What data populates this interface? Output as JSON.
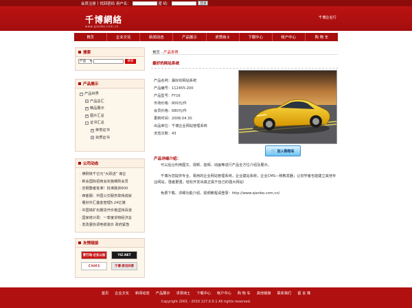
{
  "topbar": {
    "links": [
      "会员注册",
      "找回密码"
    ],
    "user_label": "用户名：",
    "pass_label": "密 码：",
    "login_button": "登录"
  },
  "header": {
    "logo": "千博網絡",
    "logo_sub": "www.qianbo.com.cn",
    "right_text": "千博企业行"
  },
  "nav": [
    "首页",
    "企业文化",
    "新闻动态",
    "产品展示",
    "求贤纳士",
    "下载中心",
    "帐户中心",
    "购 物 车"
  ],
  "sidebar": {
    "search_title": "搜索",
    "search_select": "产品",
    "search_button": "搜索",
    "products_title": "产品展示",
    "tree": [
      {
        "label": "产品世界",
        "icon": "minus-box",
        "level": 0
      },
      {
        "label": "产品总汇",
        "icon": "plus-box",
        "level": 1
      },
      {
        "label": "精品展示",
        "icon": "plus-box",
        "level": 1
      },
      {
        "label": "图片汇总",
        "icon": "plus-box",
        "level": 1
      },
      {
        "label": "证书汇总",
        "icon": "minus-box",
        "level": 1
      },
      {
        "label": "荣誉证书",
        "icon": "plus-box",
        "level": 2
      },
      {
        "label": "资质证书",
        "icon": "plus-box",
        "level": 2
      }
    ],
    "news_title": "公司动态",
    "news": [
      "佛刚铁千亿元“大跃进” 谋企",
      "新会国际招商会实施细则会员",
      "定钢整者批准！批准融资600",
      "西客服：中国公交服务取得成就",
      "看好外汇基金管理5.24亿港",
      "中国铁矿石期货开价格坚持百涨",
      "国家统计局：一季度货物经济总",
      "发改委协调电缆涨价 政府紧急"
    ],
    "links_title": "友情链接",
    "links": [
      {
        "text": "爱行动·企业公益",
        "bg": "#c81818",
        "fg": "#ffffff"
      },
      {
        "text": "YIZ.NET",
        "bg": "#1b1b1b",
        "fg": "#ffffff"
      },
      {
        "text": "ＣＮＭＳ",
        "bg": "#ffffff",
        "fg": "#b00000"
      },
      {
        "text": "千博·资讯共享",
        "bg": "#e8e8e8",
        "fg": "#b00000"
      }
    ]
  },
  "main": {
    "breadcrumb_home": "首页",
    "breadcrumb_sep": " - ",
    "breadcrumb_current": "产品世界",
    "product_title": "最好的网站系统",
    "spec": {
      "name": "产品名称：最好的网站系统",
      "code": "产品编号：112455-200",
      "model": "产品型号：FY16",
      "market_price": "市场价格：800元/件",
      "member_price": "会员价格：680元/件",
      "updated": "更新时间：2008.04.30",
      "seller": "出品单位：千博企业网站管理系统",
      "views": "浏览次数：43"
    },
    "cart_button": "加入购物车",
    "detail_title": "产品详细介绍：",
    "desc": [
      "可以后台利用图文、视频、音频、动画等进行产品全方位介绍及展示。",
      "千博为您提供专业、易用的企业网站管理系统，企业建站系统，企业CMS—移教发器；让初学者也能建立其他专业网站，强者更强，轻松开发出真正属于自己的强大网站!",
      "免费下载、详细功能介绍、视频教程请登录：http://www.qianbo.com.cn/"
    ]
  },
  "footer": {
    "links": [
      "首页",
      "企业文化",
      "新闻动态",
      "产品展示",
      "求贤纳士",
      "下载中心",
      "帐户中心",
      "购 物 车",
      "其他链接",
      "联系我们",
      "留 言 簿"
    ],
    "copyright": "Copyright 2001 - 2010 127.0.0.1 All rights reserved."
  },
  "colors": {
    "brand_red": "#a80e0e",
    "accent_red": "#cc0000",
    "sidebar_bg": "#fdf6ea"
  }
}
